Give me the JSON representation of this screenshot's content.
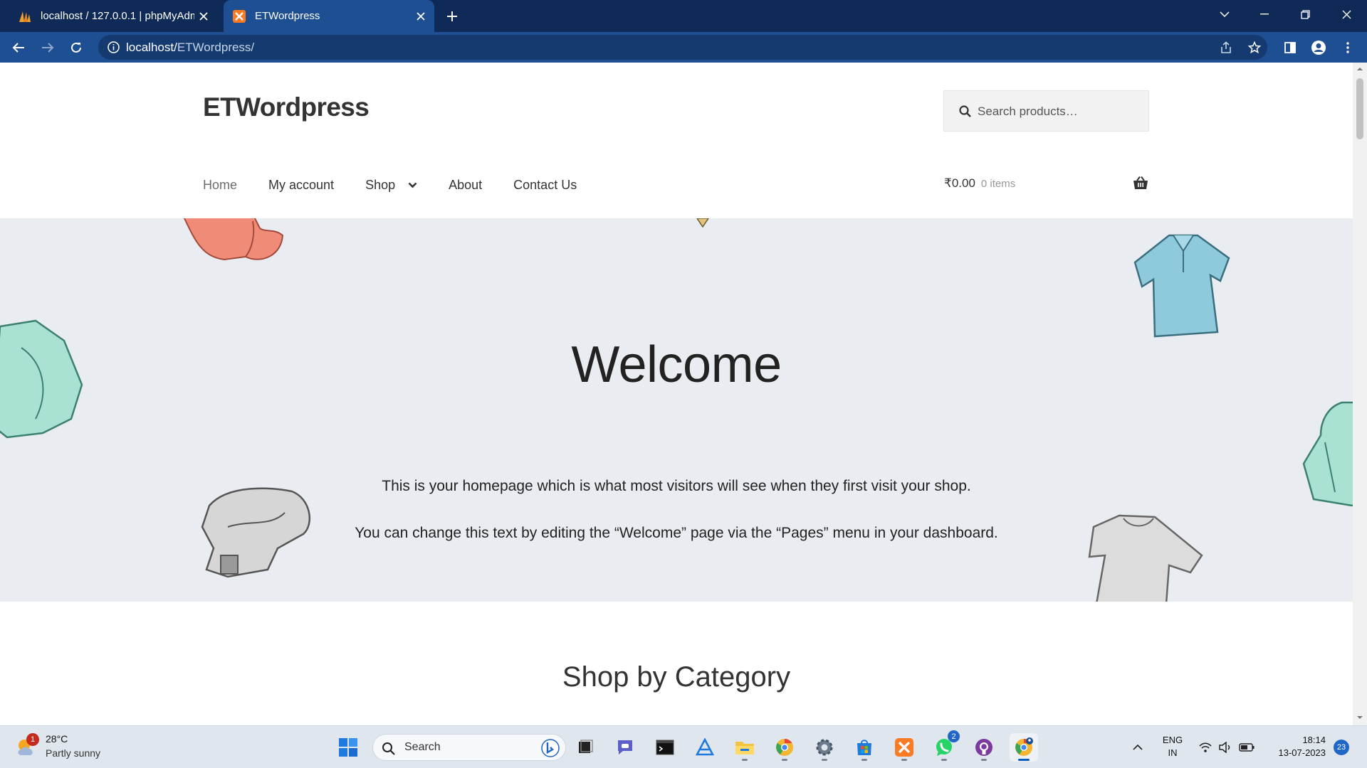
{
  "browser": {
    "tabs": [
      {
        "title": "localhost / 127.0.0.1 | phpMyAdmin",
        "favicon": "phpmyadmin-icon",
        "active": false
      },
      {
        "title": "ETWordpress",
        "favicon": "xampp-icon",
        "active": true
      }
    ],
    "url_host": "localhost/",
    "url_path": "ETWordpress/"
  },
  "site": {
    "title": "ETWordpress",
    "search_placeholder": "Search products…",
    "nav": [
      {
        "label": "Home",
        "current": true
      },
      {
        "label": "My account"
      },
      {
        "label": "Shop",
        "has_dropdown": true
      },
      {
        "label": "About"
      },
      {
        "label": "Contact Us"
      }
    ],
    "cart": {
      "amount": "₹0.00",
      "count": "0 items"
    }
  },
  "hero": {
    "heading": "Welcome",
    "line1": "This is your homepage which is what most visitors will see when they first visit your shop.",
    "line2": "You can change this text by editing the “Welcome” page via the “Pages” menu in your dashboard."
  },
  "section": {
    "title": "Shop by Category"
  },
  "taskbar": {
    "weather": {
      "temp": "28°C",
      "condition": "Partly sunny",
      "badge": "1"
    },
    "search_label": "Search",
    "apps": [
      {
        "name": "start-button"
      },
      {
        "name": "task-view-icon"
      },
      {
        "name": "teams-chat-icon"
      },
      {
        "name": "terminal-icon"
      },
      {
        "name": "azure-data-studio-icon"
      },
      {
        "name": "file-explorer-icon"
      },
      {
        "name": "chrome-canary-icon"
      },
      {
        "name": "settings-icon"
      },
      {
        "name": "microsoft-store-icon"
      },
      {
        "name": "xampp-icon"
      },
      {
        "name": "whatsapp-icon",
        "badge": "2"
      },
      {
        "name": "github-desktop-icon"
      },
      {
        "name": "chrome-icon",
        "active": true
      }
    ],
    "lang": {
      "line1": "ENG",
      "line2": "IN"
    },
    "clock": {
      "time": "18:14",
      "date": "13-07-2023"
    },
    "notifications": "23"
  }
}
